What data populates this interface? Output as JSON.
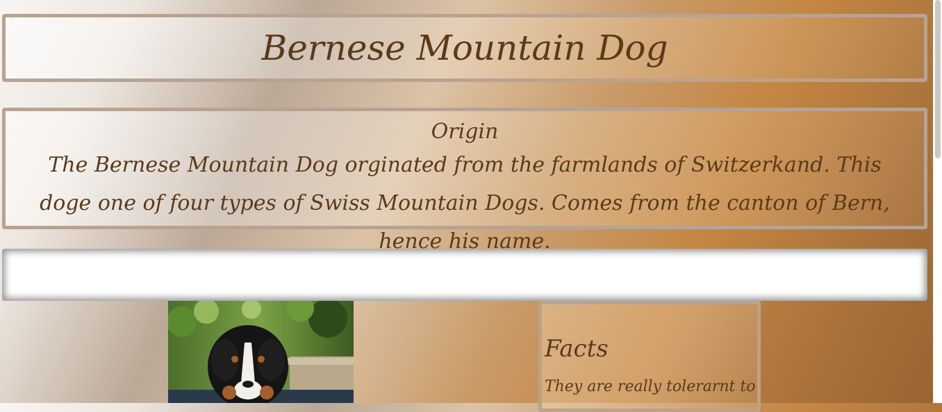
{
  "page": {
    "title": "Bernese Mountain Dog"
  },
  "origin": {
    "heading": "Origin",
    "text": "The Bernese Mountain Dog orginated from the farmlands of Switzerkand. This doge one of four types of Swiss Mountain Dogs. Comes from the canton of Bern, hence his name."
  },
  "facts": {
    "heading": "Facts",
    "text": "They are really tolerarnt to"
  },
  "colors": {
    "text": "#5a3a1a",
    "border": "#b8a392",
    "accent_orange": "#c48642"
  },
  "icons": {
    "photo": "bernese-dog-photo"
  }
}
